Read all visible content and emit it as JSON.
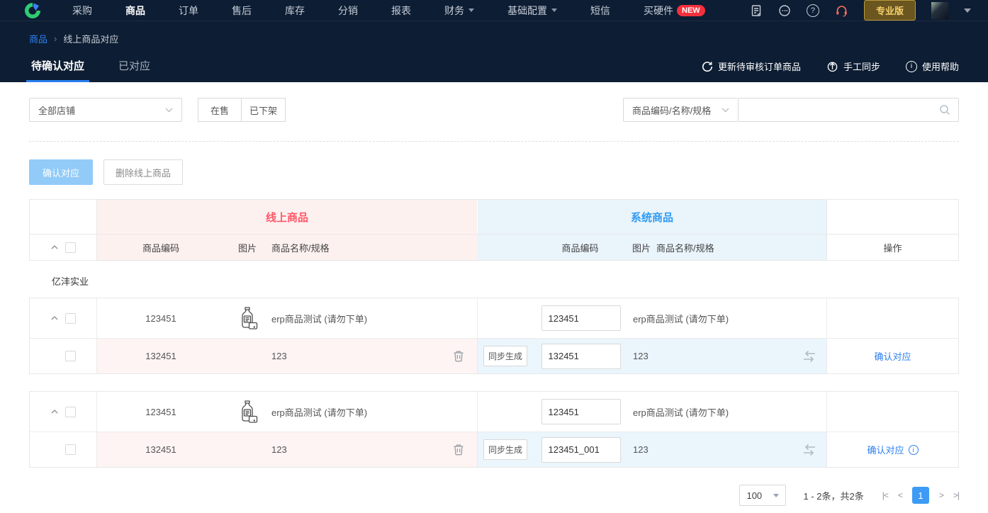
{
  "colors": {
    "navy": "#0d1d33",
    "accent_blue": "#2d80f0",
    "online_pink_bg": "#fdf1f0",
    "online_pink_text": "#ff5666",
    "system_blue_bg": "#e9f4fb",
    "system_blue_text": "#2f9bf4",
    "badge_red": "#f5303d",
    "pro_gold": "#f5d06c",
    "disabled_primary": "#92cbf8"
  },
  "icons": {
    "question": "?",
    "info": "i"
  },
  "nav": {
    "items": [
      "采购",
      "商品",
      "订单",
      "售后",
      "库存",
      "分销",
      "报表",
      "财务",
      "基础配置",
      "短信",
      "买硬件"
    ],
    "new_badge": "NEW",
    "version": "专业版"
  },
  "breadcrumb": {
    "parent": "商品",
    "sep": "›",
    "current": "线上商品对应"
  },
  "tabs": {
    "pending": "待确认对应",
    "done": "已对应"
  },
  "header_actions": {
    "update": "更新待审核订单商品",
    "sync": "手工同步",
    "help": "使用帮助"
  },
  "filters": {
    "shop": "全部店铺",
    "on_sale": "在售",
    "off_sale": "已下架",
    "search_type": "商品编码/名称/规格"
  },
  "bulk": {
    "confirm": "确认对应",
    "delete": "删除线上商品"
  },
  "table": {
    "online_title": "线上商品",
    "system_title": "系统商品",
    "col_code": "商品编码",
    "col_pic": "图片",
    "col_name": "商品名称/规格",
    "col_op": "操作",
    "shop": "亿沣实业",
    "sync_generate": "同步生成",
    "confirm": "确认对应",
    "rows": [
      {
        "online_code": "123451",
        "online_name": "erp商品测试 (请勿下单)",
        "sys_code": "123451",
        "sys_name": "erp商品测试 (请勿下单)",
        "sub_online_code": "132451",
        "sub_online_name": "123",
        "sub_sys_code": "132451",
        "sub_sys_name": "123"
      },
      {
        "online_code": "123451",
        "online_name": "erp商品测试 (请勿下单)",
        "sys_code": "123451",
        "sys_name": "erp商品测试 (请勿下单)",
        "sub_online_code": "132451",
        "sub_online_name": "123",
        "sub_sys_code": "123451_001",
        "sub_sys_name": "123"
      }
    ]
  },
  "pagination": {
    "size": "100",
    "summary": "1 - 2条，共2条",
    "first": "|<",
    "prev": "<",
    "page": "1",
    "next": ">",
    "last": ">|"
  }
}
